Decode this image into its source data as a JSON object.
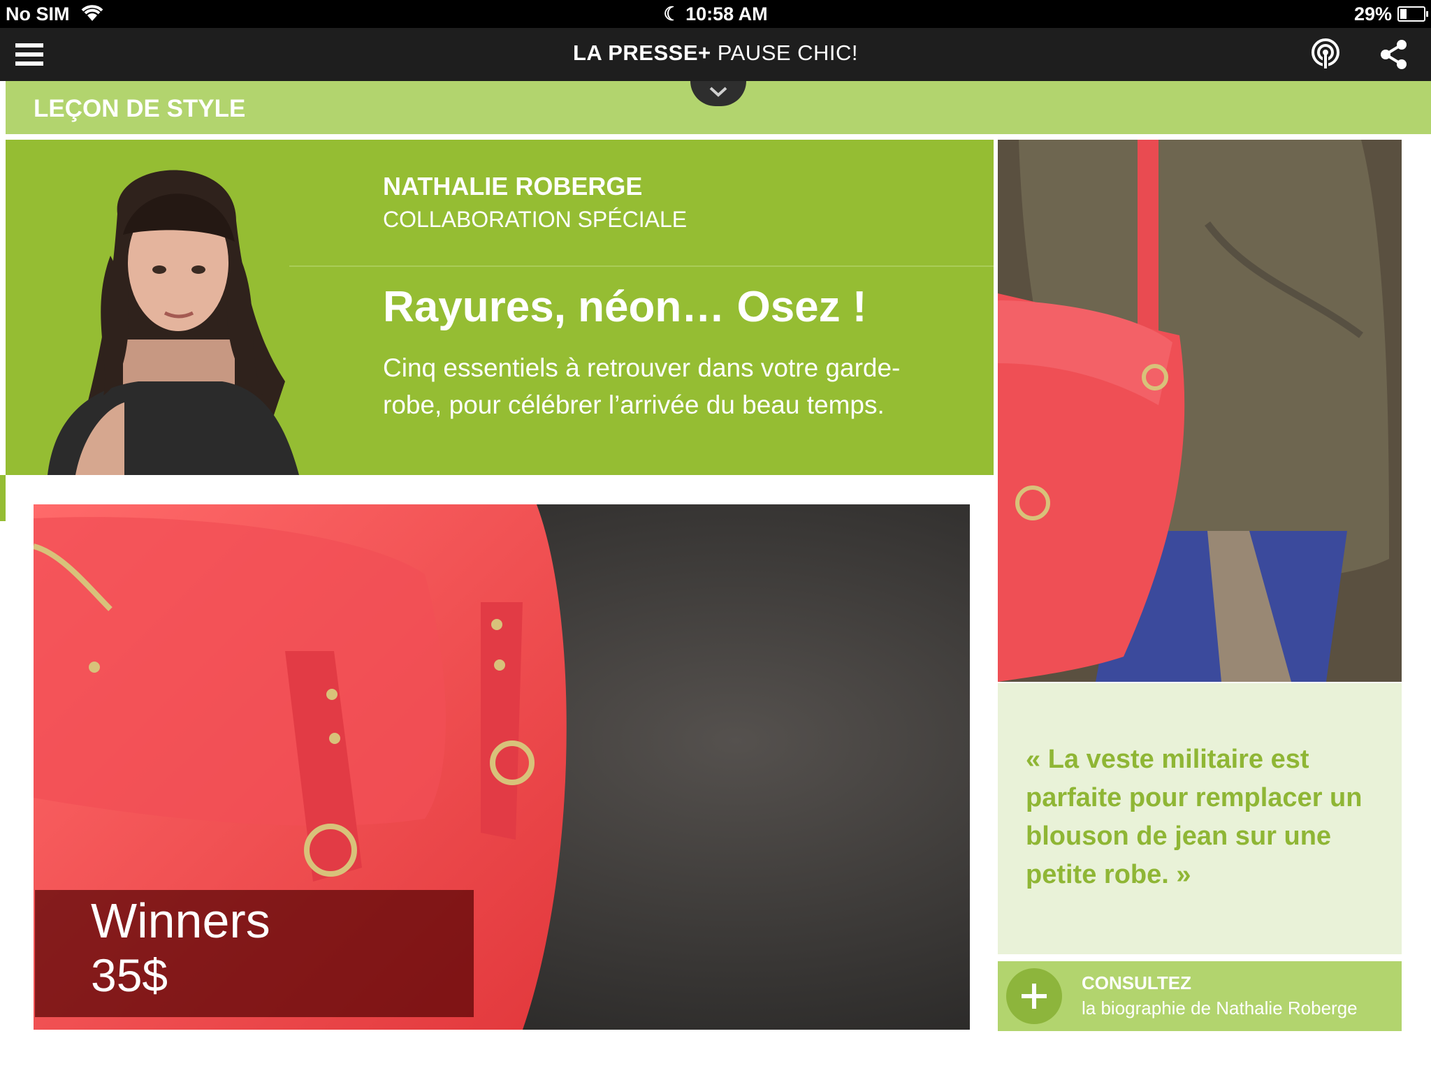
{
  "status_bar": {
    "carrier": "No SIM",
    "time": "10:58 AM",
    "battery": "29%",
    "battery_level": 0.29
  },
  "navbar": {
    "brand": "LA PRESSE+",
    "section": "PAUSE CHIC!",
    "icons": [
      "menu-icon",
      "podcast-icon",
      "share-icon"
    ]
  },
  "section": {
    "label": "LEÇON DE STYLE"
  },
  "article": {
    "author": "NATHALIE ROBERGE",
    "author_role": "COLLABORATION SPÉCIALE",
    "headline": "Rayures, néon… Osez !",
    "dek": "Cinq essentiels à retrouver dans votre garde-robe, pour célébrer l’arrivée du beau temps."
  },
  "product": {
    "store": "Winners",
    "price": "35$"
  },
  "quote": {
    "text": "« La veste militaire est parfaite pour remplacer un blouson de jean sur une petite robe. »"
  },
  "cta": {
    "title": "CONSULTEZ",
    "subtitle": "la biographie de Nathalie Roberge"
  },
  "colors": {
    "green_dark": "#95bd33",
    "green_light": "#b2d46e",
    "green_pale": "#e9f2d8",
    "quote_text": "#8fb635",
    "navbar": "#1e1e1e",
    "bag_red": "#f04a4a"
  }
}
